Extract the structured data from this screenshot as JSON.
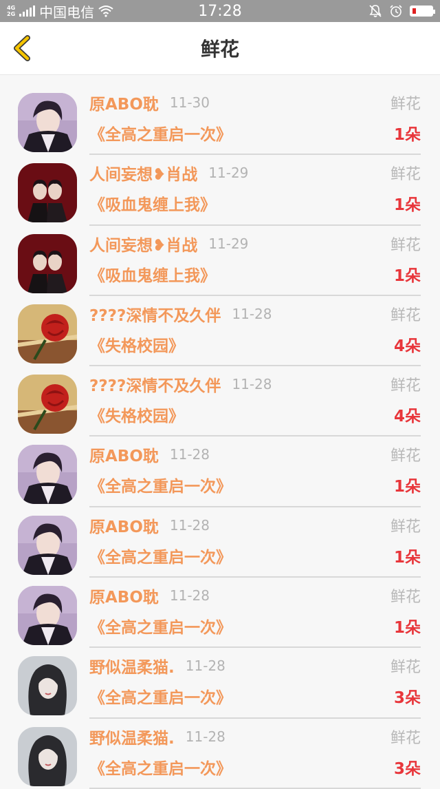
{
  "statusbar": {
    "network_top": "4G",
    "network_bottom": "2G",
    "carrier": "中国电信",
    "time": "17:28",
    "icons": [
      "signal-icon",
      "wifi-icon",
      "mute-icon",
      "alarm-icon",
      "battery-icon"
    ]
  },
  "header": {
    "title": "鲜花",
    "back_icon": "chevron-left-icon",
    "back_color": "#f5c400"
  },
  "colors": {
    "name": "#f3985a",
    "count": "#e8363b",
    "muted": "#b3b3b3"
  },
  "items": [
    {
      "name": "原ABO耽",
      "date": "11-30",
      "type": "鲜花",
      "book": "《全高之重启一次》",
      "count": "1朵",
      "avatar": "purple-portrait"
    },
    {
      "name": "人间妄想❥肖战",
      "date": "11-29",
      "type": "鲜花",
      "book": "《吸血鬼缠上我》",
      "count": "1朵",
      "avatar": "duo-dark-red"
    },
    {
      "name": "人间妄想❥肖战",
      "date": "11-29",
      "type": "鲜花",
      "book": "《吸血鬼缠上我》",
      "count": "1朵",
      "avatar": "duo-dark-red"
    },
    {
      "name": "????深情不及久伴",
      "date": "11-28",
      "type": "鲜花",
      "book": "《失格校园》",
      "count": "4朵",
      "avatar": "rose"
    },
    {
      "name": "????深情不及久伴",
      "date": "11-28",
      "type": "鲜花",
      "book": "《失格校园》",
      "count": "4朵",
      "avatar": "rose"
    },
    {
      "name": "原ABO耽",
      "date": "11-28",
      "type": "鲜花",
      "book": "《全高之重启一次》",
      "count": "1朵",
      "avatar": "purple-portrait"
    },
    {
      "name": "原ABO耽",
      "date": "11-28",
      "type": "鲜花",
      "book": "《全高之重启一次》",
      "count": "1朵",
      "avatar": "purple-portrait"
    },
    {
      "name": "原ABO耽",
      "date": "11-28",
      "type": "鲜花",
      "book": "《全高之重启一次》",
      "count": "1朵",
      "avatar": "purple-portrait"
    },
    {
      "name": "野似温柔猫.",
      "date": "11-28",
      "type": "鲜花",
      "book": "《全高之重启一次》",
      "count": "3朵",
      "avatar": "grey-girl"
    },
    {
      "name": "野似温柔猫.",
      "date": "11-28",
      "type": "鲜花",
      "book": "《全高之重启一次》",
      "count": "3朵",
      "avatar": "grey-girl"
    }
  ]
}
